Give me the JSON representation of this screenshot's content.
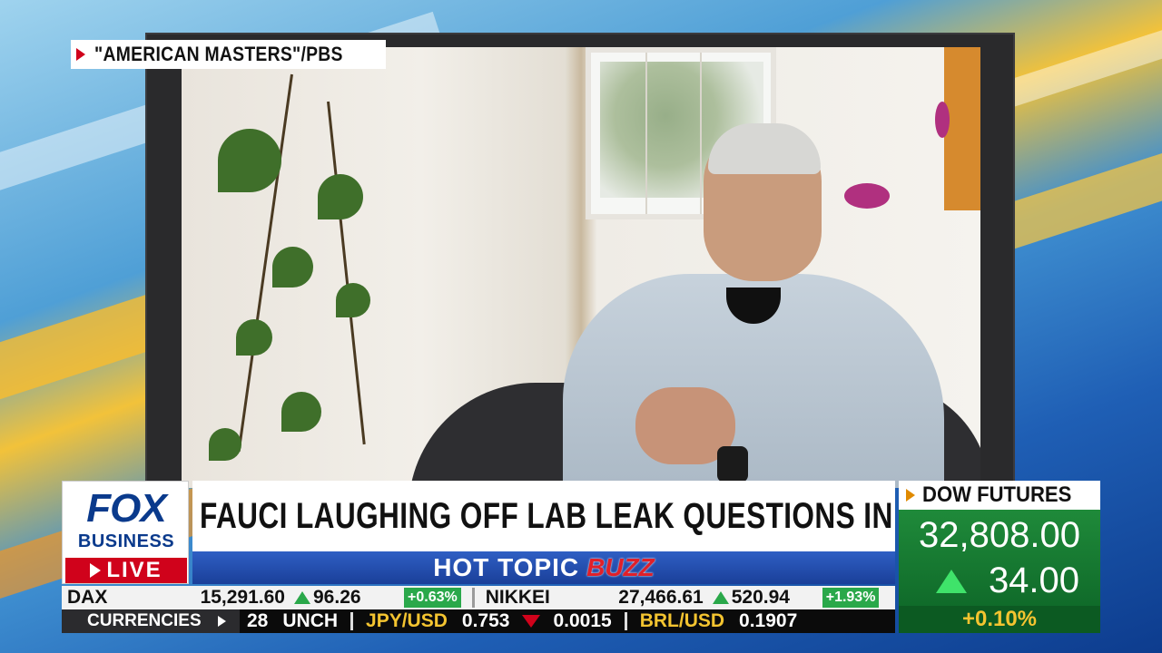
{
  "credit": {
    "text": "\"AMERICAN MASTERS\"/PBS",
    "icon": "play-triangle-icon"
  },
  "logo": {
    "fox": "FOX",
    "business": "BUSINESS",
    "live": "LIVE"
  },
  "headline": "FAUCI LAUGHING OFF LAB LEAK QUESTIONS IN NEW DOC",
  "topic": {
    "part1": "HOT TOPIC",
    "part2": "BUZZ"
  },
  "ticker_top": [
    {
      "name": "DAX",
      "value": "15,291.60",
      "change": "96.26",
      "pct": "+0.63%",
      "direction": "up"
    },
    {
      "name": "NIKKEI",
      "value": "27,466.61",
      "change": "520.94",
      "pct": "+1.93%",
      "direction": "up"
    }
  ],
  "ticker_bottom": {
    "label": "CURRENCIES",
    "items": [
      {
        "text": "28",
        "color": "#ffffff"
      },
      {
        "text": "UNCH",
        "color": "#ffffff"
      },
      {
        "text": "JPY/USD",
        "color": "#f4c430"
      },
      {
        "text": "0.753",
        "color": "#ffffff"
      },
      {
        "text": "0.0015",
        "color": "#ffffff",
        "direction": "down"
      },
      {
        "text": "BRL/USD",
        "color": "#f4c430"
      },
      {
        "text": "0.1907",
        "color": "#ffffff"
      }
    ]
  },
  "dow": {
    "label": "DOW FUTURES",
    "value": "32,808.00",
    "change": "34.00",
    "pct": "+0.10%",
    "direction": "up"
  },
  "colors": {
    "fox_blue": "#0a3a8c",
    "live_red": "#d0021b",
    "up_green": "#2aa84a",
    "dow_green": "#1f8a3a",
    "accent_yellow": "#f4c430"
  }
}
